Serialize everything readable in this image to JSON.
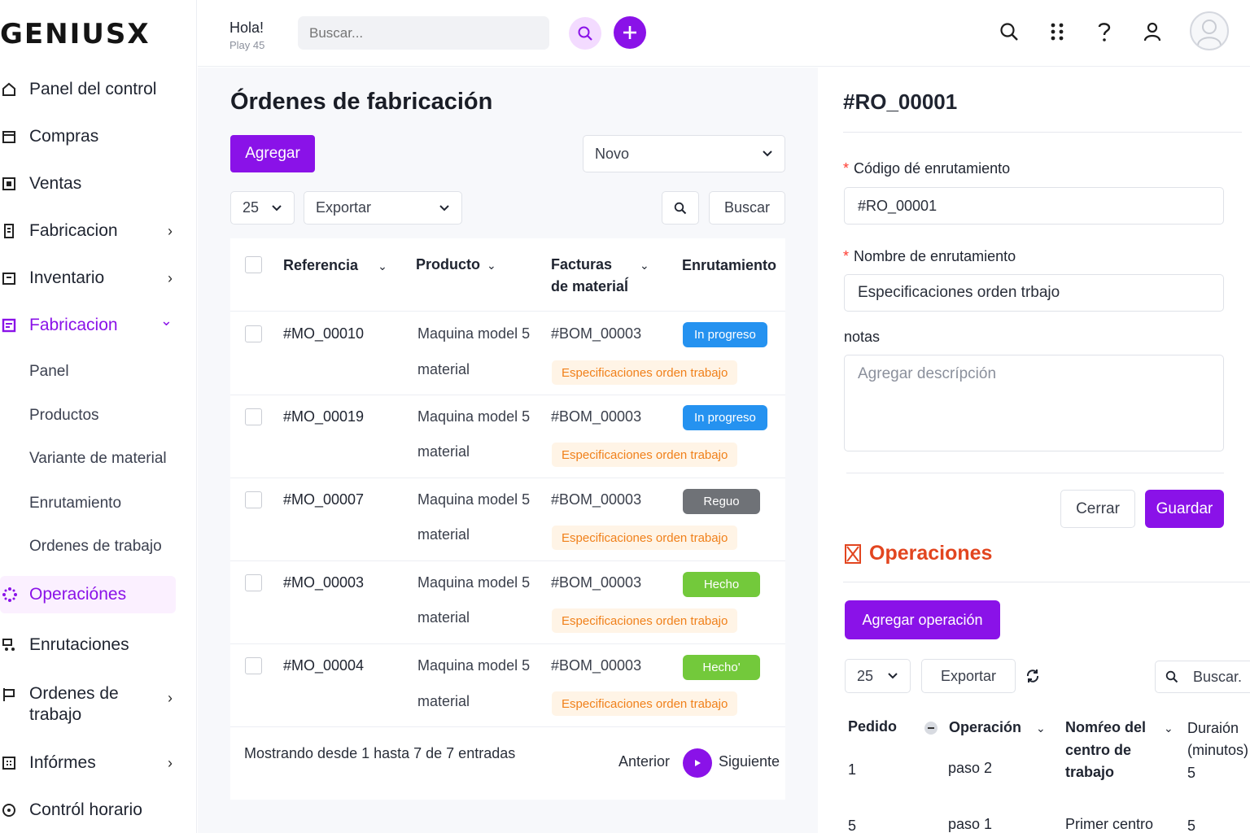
{
  "brand": {
    "logo": "GENIUSX",
    "accent": "#8a12e8"
  },
  "topbar": {
    "greeting": "Hola!",
    "greeting_sub": "Play 45",
    "search_placeholder": "Buscar...",
    "icons": [
      "search-icon",
      "apps-grid-icon",
      "help-icon",
      "user-icon",
      "avatar"
    ]
  },
  "sidebar": {
    "items": [
      {
        "label": "Panel del control",
        "icon": "home-icon"
      },
      {
        "label": "Compras",
        "icon": "purchases-icon"
      },
      {
        "label": "Ventas",
        "icon": "sales-icon"
      },
      {
        "label": "Fabricacion",
        "icon": "manufacturing-icon",
        "chevron": "›"
      },
      {
        "label": "Inventario",
        "icon": "inventory-icon",
        "chevron": "›"
      },
      {
        "label": "Fabricacion",
        "icon": "manufacturing-icon",
        "chevron": "⌄",
        "expanded": true
      },
      {
        "label": "Operaciónes",
        "icon": "operations-icon",
        "active": true
      },
      {
        "label": "Enrutaciones",
        "icon": "routing-icon"
      },
      {
        "label": "Ordenes de trabajo",
        "icon": "work-order-icon",
        "chevron": "›"
      },
      {
        "label": "Infórmes",
        "icon": "reports-icon",
        "chevron": "›"
      },
      {
        "label": "Contról horario",
        "icon": "clock-icon"
      }
    ],
    "subitems": [
      "Panel",
      "Productos",
      "Variante de material",
      "Enrutamiento",
      "Ordenes de trabajo"
    ]
  },
  "list": {
    "title": "Órdenes de fabricación",
    "add_label": "Agregar",
    "filter_value": "Novo",
    "page_size": "25",
    "export_label": "Exportar",
    "search_label": "Buscar",
    "columns": {
      "reference": "Referencia",
      "product": "Producto",
      "bom_line1": "Facturas",
      "bom_line2": "de materiaĺ",
      "routing": "Enrutamiento"
    },
    "rows": [
      {
        "ref": "#MO_00010",
        "product": "Maquina model 5",
        "product2": "material",
        "bom": "#BOM_00003",
        "status": "In progreso",
        "status_color": "#2592f0",
        "spec": "Especificaciones orden trabajo"
      },
      {
        "ref": "#MO_00019",
        "product": "Maquina model 5",
        "product2": "material",
        "bom": "#BOM_00003",
        "status": "In progreso",
        "status_color": "#2592f0",
        "spec": "Especificaciones orden trabajo"
      },
      {
        "ref": "#MO_00007",
        "product": "Maquina model 5",
        "product2": "material",
        "bom": "#BOM_00003",
        "status": "Reguo",
        "status_color": "#6f7277",
        "spec": "Especificaciones orden trabajo"
      },
      {
        "ref": "#MO_00003",
        "product": "Maquina model 5",
        "product2": "material",
        "bom": "#BOM_00003",
        "status": "Hecho",
        "status_color": "#73c93b",
        "spec": "Especificaciones orden trabajo"
      },
      {
        "ref": "#MO_00004",
        "product": "Maquina model 5",
        "product2": "material",
        "bom": "#BOM_00003",
        "status": "Hecho'",
        "status_color": "#73c93b",
        "spec": "Especificaciones orden trabajo"
      }
    ],
    "footer": "Mostrando desde 1 hasta 7 de 7 entradas",
    "prev_label": "Anterior",
    "next_label": "Siguiente"
  },
  "detail": {
    "title": "#RO_00001",
    "code_label": "Código dé enrutamiento",
    "code_value": "#RO_00001",
    "name_label": "Nombre de enrutamiento",
    "name_value": "Especificaciones orden trbajo",
    "notes_label": "notas",
    "notes_placeholder": "Agregar descrípción",
    "close_label": "Cerrar",
    "save_label": "Guardar"
  },
  "operations": {
    "title": "Operaciones",
    "add_label": "Agregar operación",
    "page_size": "25",
    "export_label": "Exportar",
    "search_label": "Buscar.",
    "columns": {
      "order": "Pedido",
      "operation": "Operación",
      "workcenter_l1": "Nomŕeo del",
      "workcenter_l2": "centro de",
      "workcenter_l3": "trabajo",
      "duration_l1": "Duraión",
      "duration_l2": "(minutos)"
    },
    "rows": [
      {
        "order": "1",
        "operation": "paso 2",
        "workcenter": "",
        "duration": "5"
      },
      {
        "order": "5",
        "operation": "paso 1",
        "workcenter": "Primer centro",
        "duration": "5"
      }
    ]
  }
}
